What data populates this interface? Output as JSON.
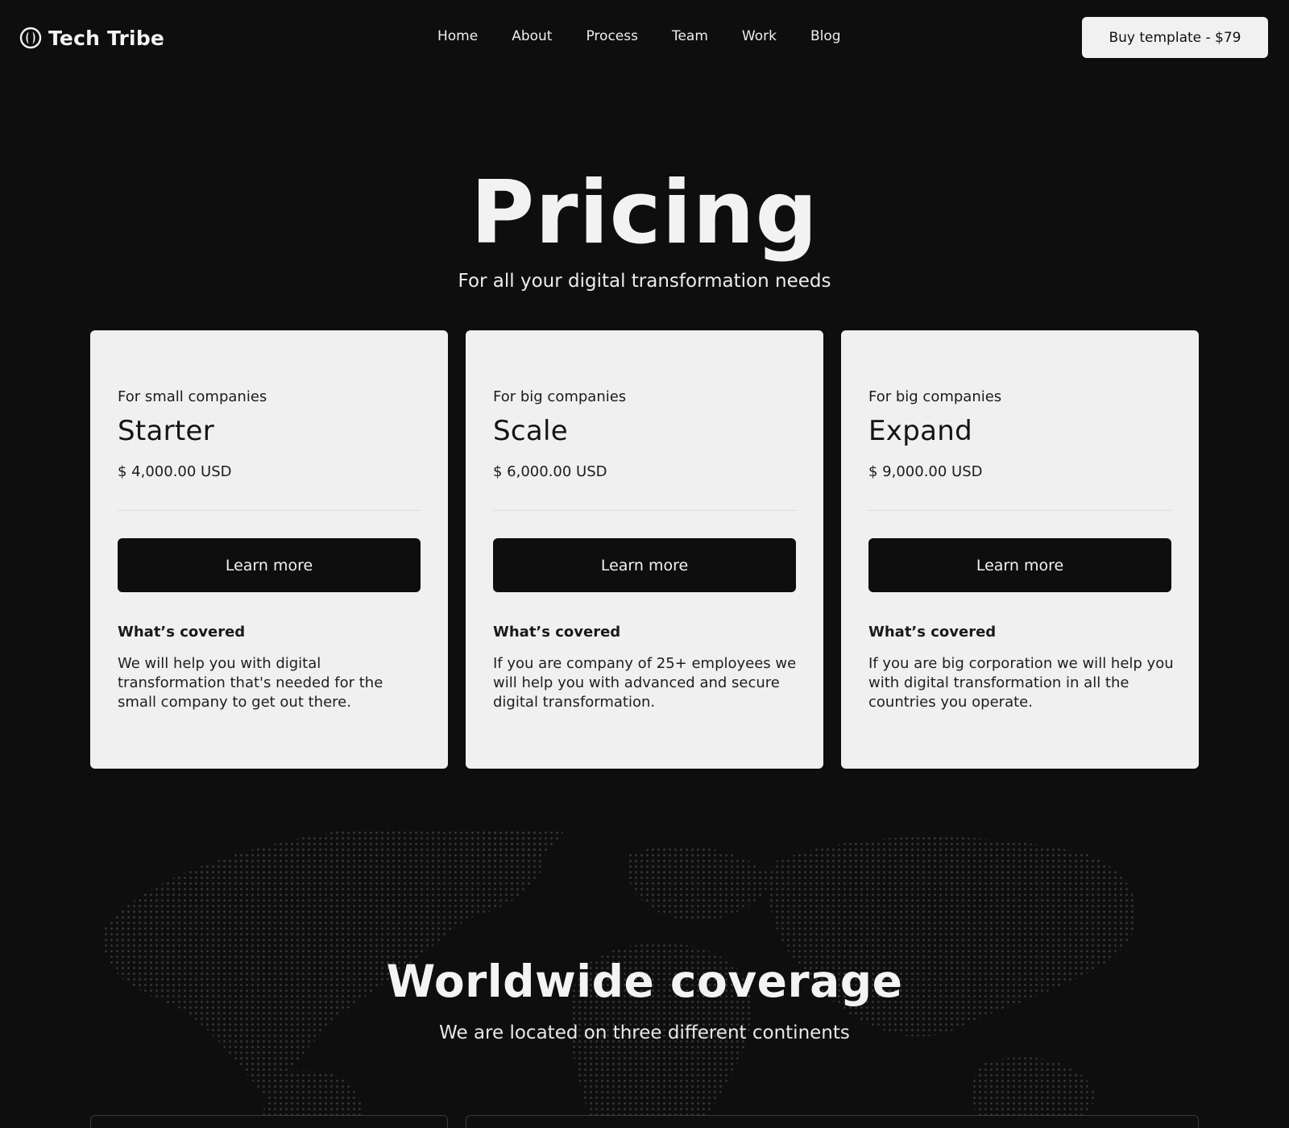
{
  "brand": {
    "name": "Tech Tribe",
    "logo_icon": "tech-tribe-logo-icon"
  },
  "nav": {
    "items": [
      {
        "label": "Home"
      },
      {
        "label": "About"
      },
      {
        "label": "Process"
      },
      {
        "label": "Team"
      },
      {
        "label": "Work"
      },
      {
        "label": "Blog"
      }
    ]
  },
  "header": {
    "buy_label": "Buy template - $79"
  },
  "hero": {
    "title": "Pricing",
    "subtitle": "For all your digital transformation needs"
  },
  "plans": [
    {
      "audience": "For small companies",
      "name": "Starter",
      "price": "$ 4,000.00 USD",
      "cta": "Learn more",
      "covered_heading": "What’s covered",
      "covered_text": "We will help you with digital transformation that's needed for the small company to get out there."
    },
    {
      "audience": "For big companies",
      "name": "Scale",
      "price": "$ 6,000.00 USD",
      "cta": "Learn more",
      "covered_heading": "What’s covered",
      "covered_text": "If you are company of 25+ employees we will help you with advanced and secure digital transformation."
    },
    {
      "audience": "For big companies",
      "name": "Expand",
      "price": "$ 9,000.00 USD",
      "cta": "Learn more",
      "covered_heading": "What’s covered",
      "covered_text": "If you are big corporation we will help you with digital transformation in all the countries you operate."
    }
  ],
  "coverage": {
    "title": "Worldwide coverage",
    "subtitle": "We are located on three different continents"
  },
  "colors": {
    "background": "#0e0e0f",
    "card": "#f0f0f0",
    "button_dark": "#0e0e0f",
    "text_light": "#f2f2f2"
  }
}
